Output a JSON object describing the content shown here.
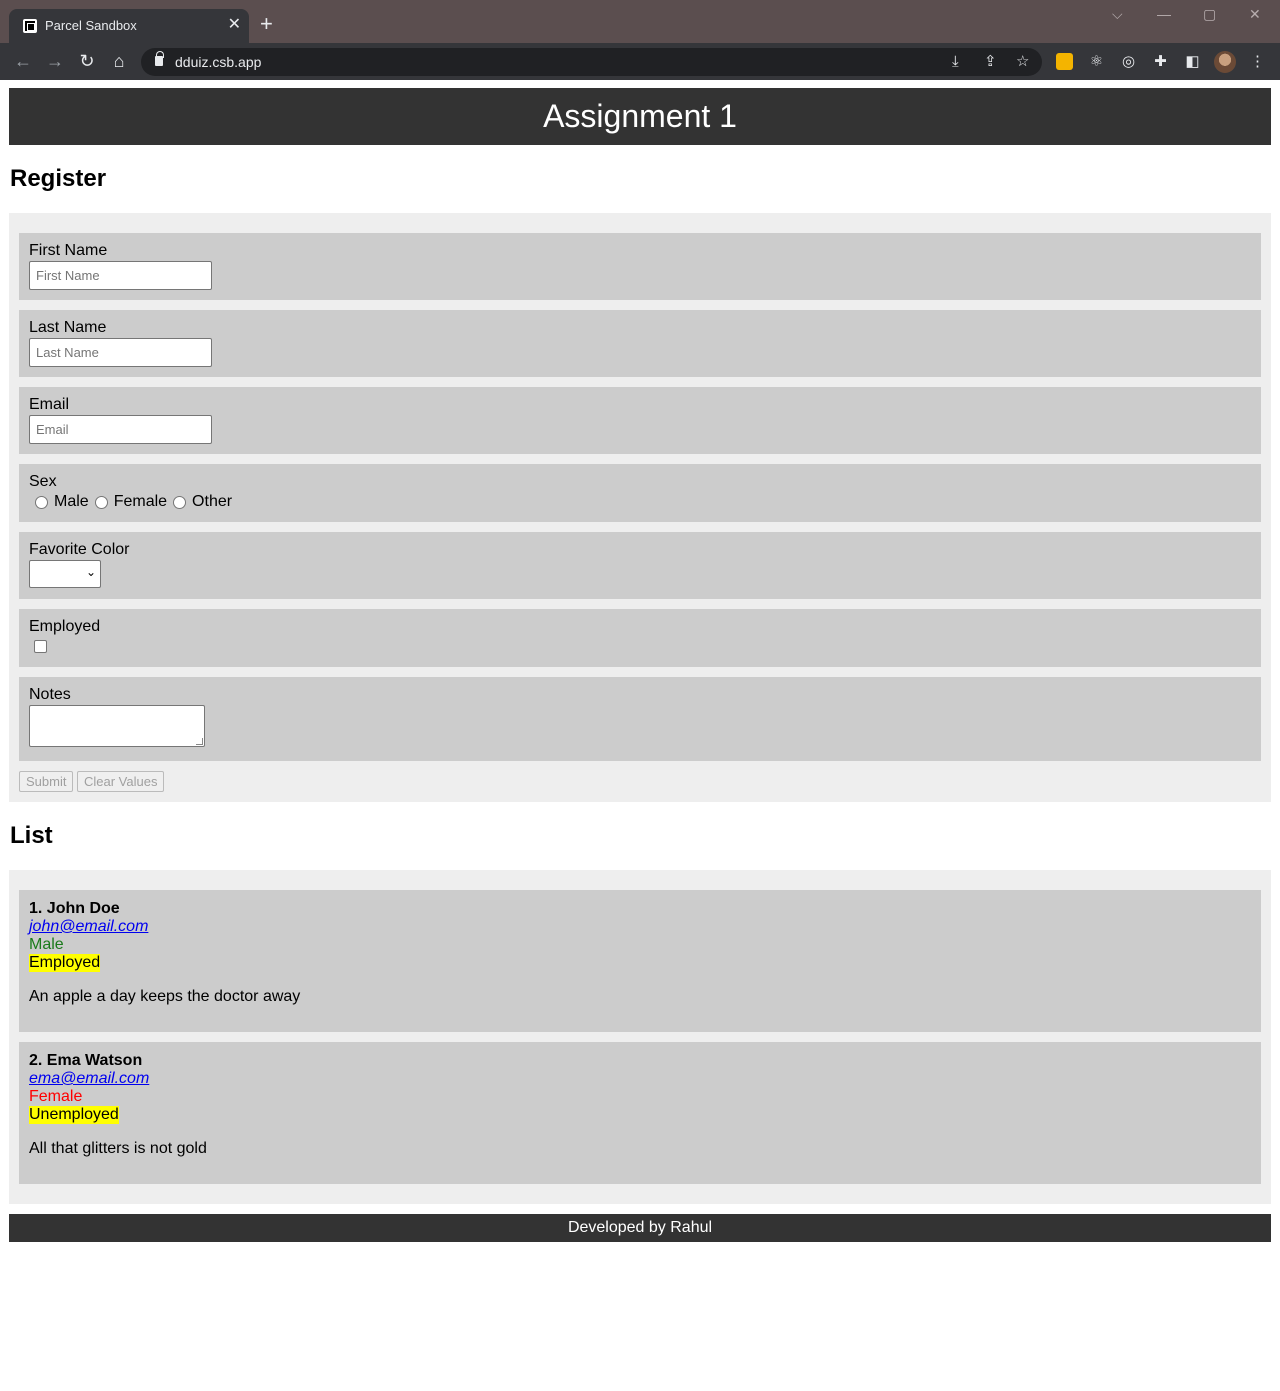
{
  "browser": {
    "tab_title": "Parcel Sandbox",
    "tab_close": "✕",
    "new_tab": "+",
    "url": "dduiz.csb.app",
    "window_controls": [
      "⌵",
      "—",
      "▢",
      "✕"
    ]
  },
  "page": {
    "header_title": "Assignment 1",
    "register_heading": "Register",
    "form": {
      "first_name": {
        "label": "First Name",
        "placeholder": "First Name",
        "value": ""
      },
      "last_name": {
        "label": "Last Name",
        "placeholder": "Last Name",
        "value": ""
      },
      "email": {
        "label": "Email",
        "placeholder": "Email",
        "value": ""
      },
      "sex": {
        "label": "Sex",
        "options": [
          "Male",
          "Female",
          "Other"
        ]
      },
      "favorite_color": {
        "label": "Favorite Color",
        "selected": ""
      },
      "employed": {
        "label": "Employed",
        "checked": false
      },
      "notes": {
        "label": "Notes",
        "value": ""
      },
      "submit_label": "Submit",
      "clear_label": "Clear Values"
    },
    "list_heading": "List",
    "entries": [
      {
        "name": "1. John Doe",
        "email": "john@email.com",
        "sex": "Male",
        "employment": "Employed",
        "note": "An apple a day keeps the doctor away"
      },
      {
        "name": "2. Ema Watson",
        "email": "ema@email.com",
        "sex": "Female",
        "employment": "Unemployed",
        "note": "All that glitters is not gold"
      }
    ],
    "footer": "Developed by Rahul"
  },
  "colors": {
    "header_bg": "#333333",
    "panel_bg": "#eeeeee",
    "field_bg": "#cccccc",
    "male": "#1a7a1a",
    "female": "#ff0000",
    "employment_highlight": "#ffff00",
    "link": "#0000ee"
  }
}
